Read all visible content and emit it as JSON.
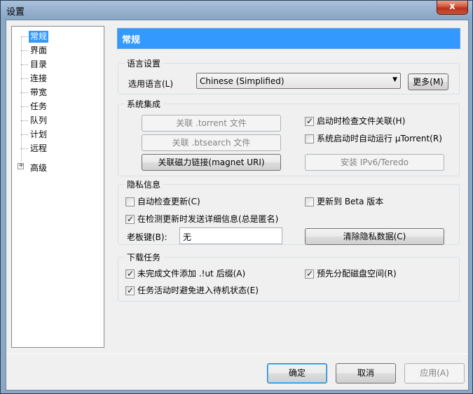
{
  "window": {
    "title": "设置",
    "close_glyph": "x"
  },
  "tree": {
    "items": [
      {
        "label": "常规",
        "selected": true
      },
      {
        "label": "界面"
      },
      {
        "label": "目录"
      },
      {
        "label": "连接"
      },
      {
        "label": "带宽"
      },
      {
        "label": "任务"
      },
      {
        "label": "队列"
      },
      {
        "label": "计划"
      },
      {
        "label": "远程"
      },
      {
        "label": "高级",
        "expandable": true
      }
    ],
    "expander_glyph": "+"
  },
  "panel": {
    "header": "常规"
  },
  "language": {
    "legend": "语言设置",
    "select_label": "选用语言(L)",
    "selected_language": "Chinese (Simplified)",
    "more_button": "更多(M)"
  },
  "integration": {
    "legend": "系统集成",
    "torrent_assoc": "关联 .torrent 文件",
    "btsearch_assoc": "关联 .btsearch 文件",
    "magnet_assoc": "关联磁力链接(magnet URI)",
    "check_assoc_on_start": {
      "label": "启动时检查文件关联(H)",
      "checked": true
    },
    "start_with_system": {
      "label": "系统启动时自动运行 µTorrent(R)",
      "checked": false
    },
    "install_ipv6": "安装 IPv6/Teredo"
  },
  "privacy": {
    "legend": "隐私信息",
    "auto_check_updates": {
      "label": "自动检查更新(C)",
      "checked": false
    },
    "update_beta": {
      "label": "更新到 Beta 版本",
      "checked": false
    },
    "send_details": {
      "label": "在检测更新时发送详细信息(总是匿名)",
      "checked": true
    },
    "boss_key_label": "老板键(B):",
    "boss_key_value": "无",
    "clear_private": "清除隐私数据(C)"
  },
  "downloads": {
    "legend": "下载任务",
    "append_ut": {
      "label": "未完成文件添加 .!ut 后缀(A)",
      "checked": true
    },
    "preallocate": {
      "label": "预先分配磁盘空间(R)",
      "checked": true
    },
    "prevent_standby": {
      "label": "任务活动时避免进入待机状态(E)",
      "checked": true
    }
  },
  "footer": {
    "ok": "确定",
    "cancel": "取消",
    "apply": "应用(A)"
  },
  "check_glyph": "✓"
}
